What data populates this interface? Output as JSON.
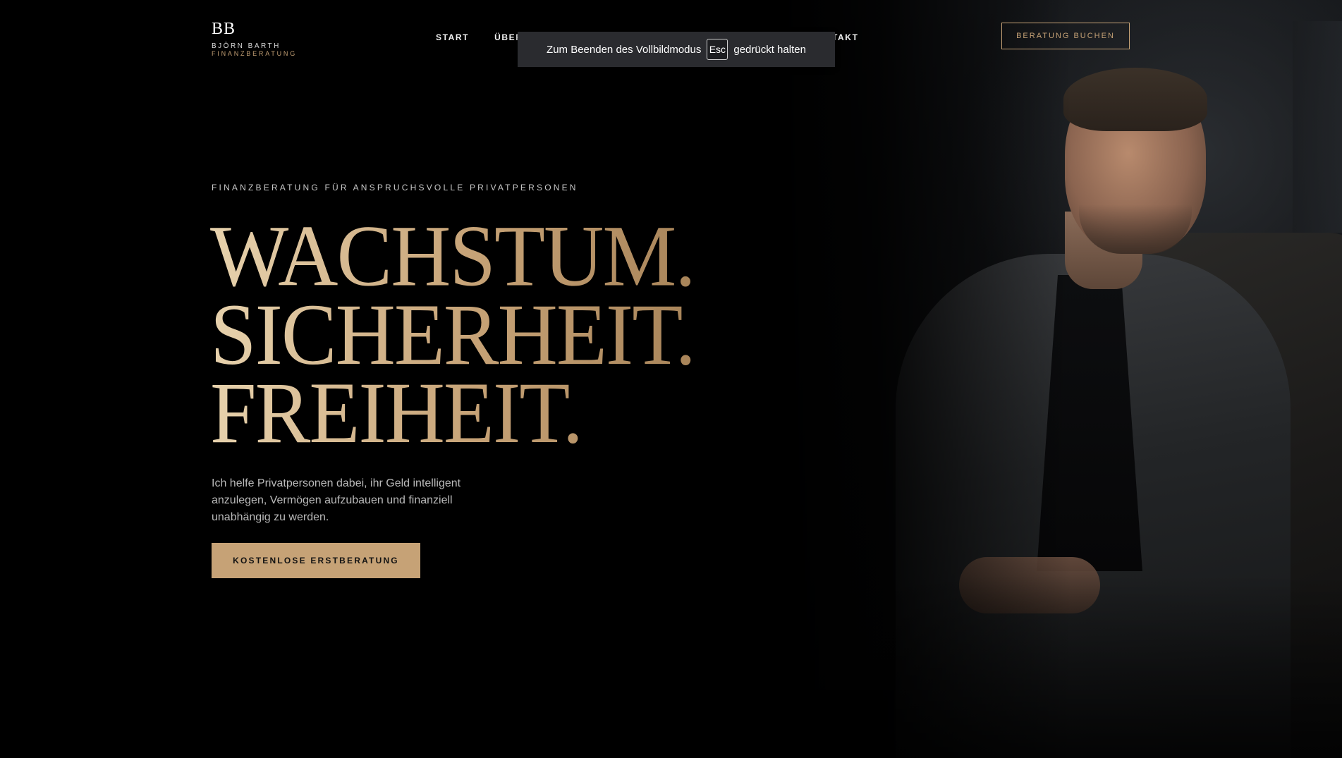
{
  "brand": {
    "mark": "BB",
    "name": "BJÖRN BARTH",
    "subtitle": "FINANZBERATUNG"
  },
  "nav": {
    "items": [
      {
        "label": "START"
      },
      {
        "label": "ÜBER"
      }
    ],
    "contact_fragment": "TAKT",
    "cta_label": "BERATUNG BUCHEN"
  },
  "fullscreen_toast": {
    "before": "Zum Beenden des Vollbildmodus",
    "key": "Esc",
    "after": "gedrückt halten"
  },
  "hero": {
    "eyebrow": "FINANZBERATUNG FÜR ANSPRUCHSVOLLE PRIVATPERSONEN",
    "headline": [
      "WACHSTUM.",
      "SICHERHEIT.",
      "FREIHEIT."
    ],
    "lead": "Ich helfe Privatpersonen dabei, ihr Geld intelligent anzulegen, Vermögen aufzubauen und finanziell unabhängig zu werden.",
    "cta_label": "KOSTENLOSE ERSTBERATUNG"
  },
  "colors": {
    "background": "#000000",
    "accent_gold": "#c6a276",
    "toast_bg": "#2a2b2f"
  }
}
